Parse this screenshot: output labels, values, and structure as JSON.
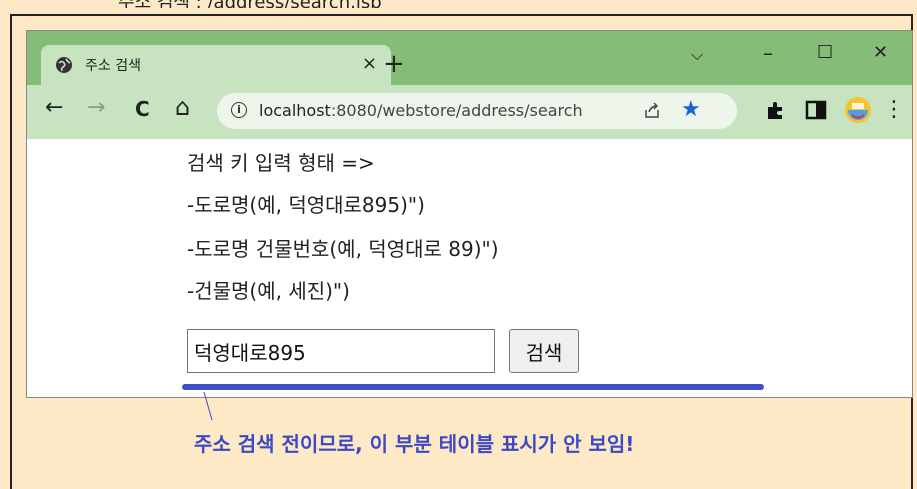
{
  "top_caption": "주소 검색 : /address/search.jsp",
  "browser": {
    "tab": {
      "title": "주소 검색",
      "close_glyph": "×"
    },
    "new_tab_glyph": "+",
    "window_controls": {
      "chevron": "⌵",
      "minimize": "–",
      "maximize": "☐",
      "close": "✕"
    },
    "toolbar": {
      "back": "←",
      "forward": "→",
      "reload": "C",
      "home": "⌂",
      "url_host": "localhost",
      "url_rest": ":8080/webstore/address/search",
      "info_glyph": "i",
      "star_glyph": "★",
      "menu_glyph": "⋮"
    }
  },
  "content": {
    "lines": [
      "검색 키 입력 형태 =>",
      "-도로명(예, 덕영대로895)\")",
      "-도로명 건물번호(예, 덕영대로 89)\")",
      "-건물명(예, 세진)\")"
    ],
    "search_value": "덕영대로895",
    "search_button": "검색"
  },
  "annotation": {
    "note": "주소 검색 전이므로, 이 부분 테이블 표시가 안 보임!",
    "color": "#3d49c4"
  }
}
